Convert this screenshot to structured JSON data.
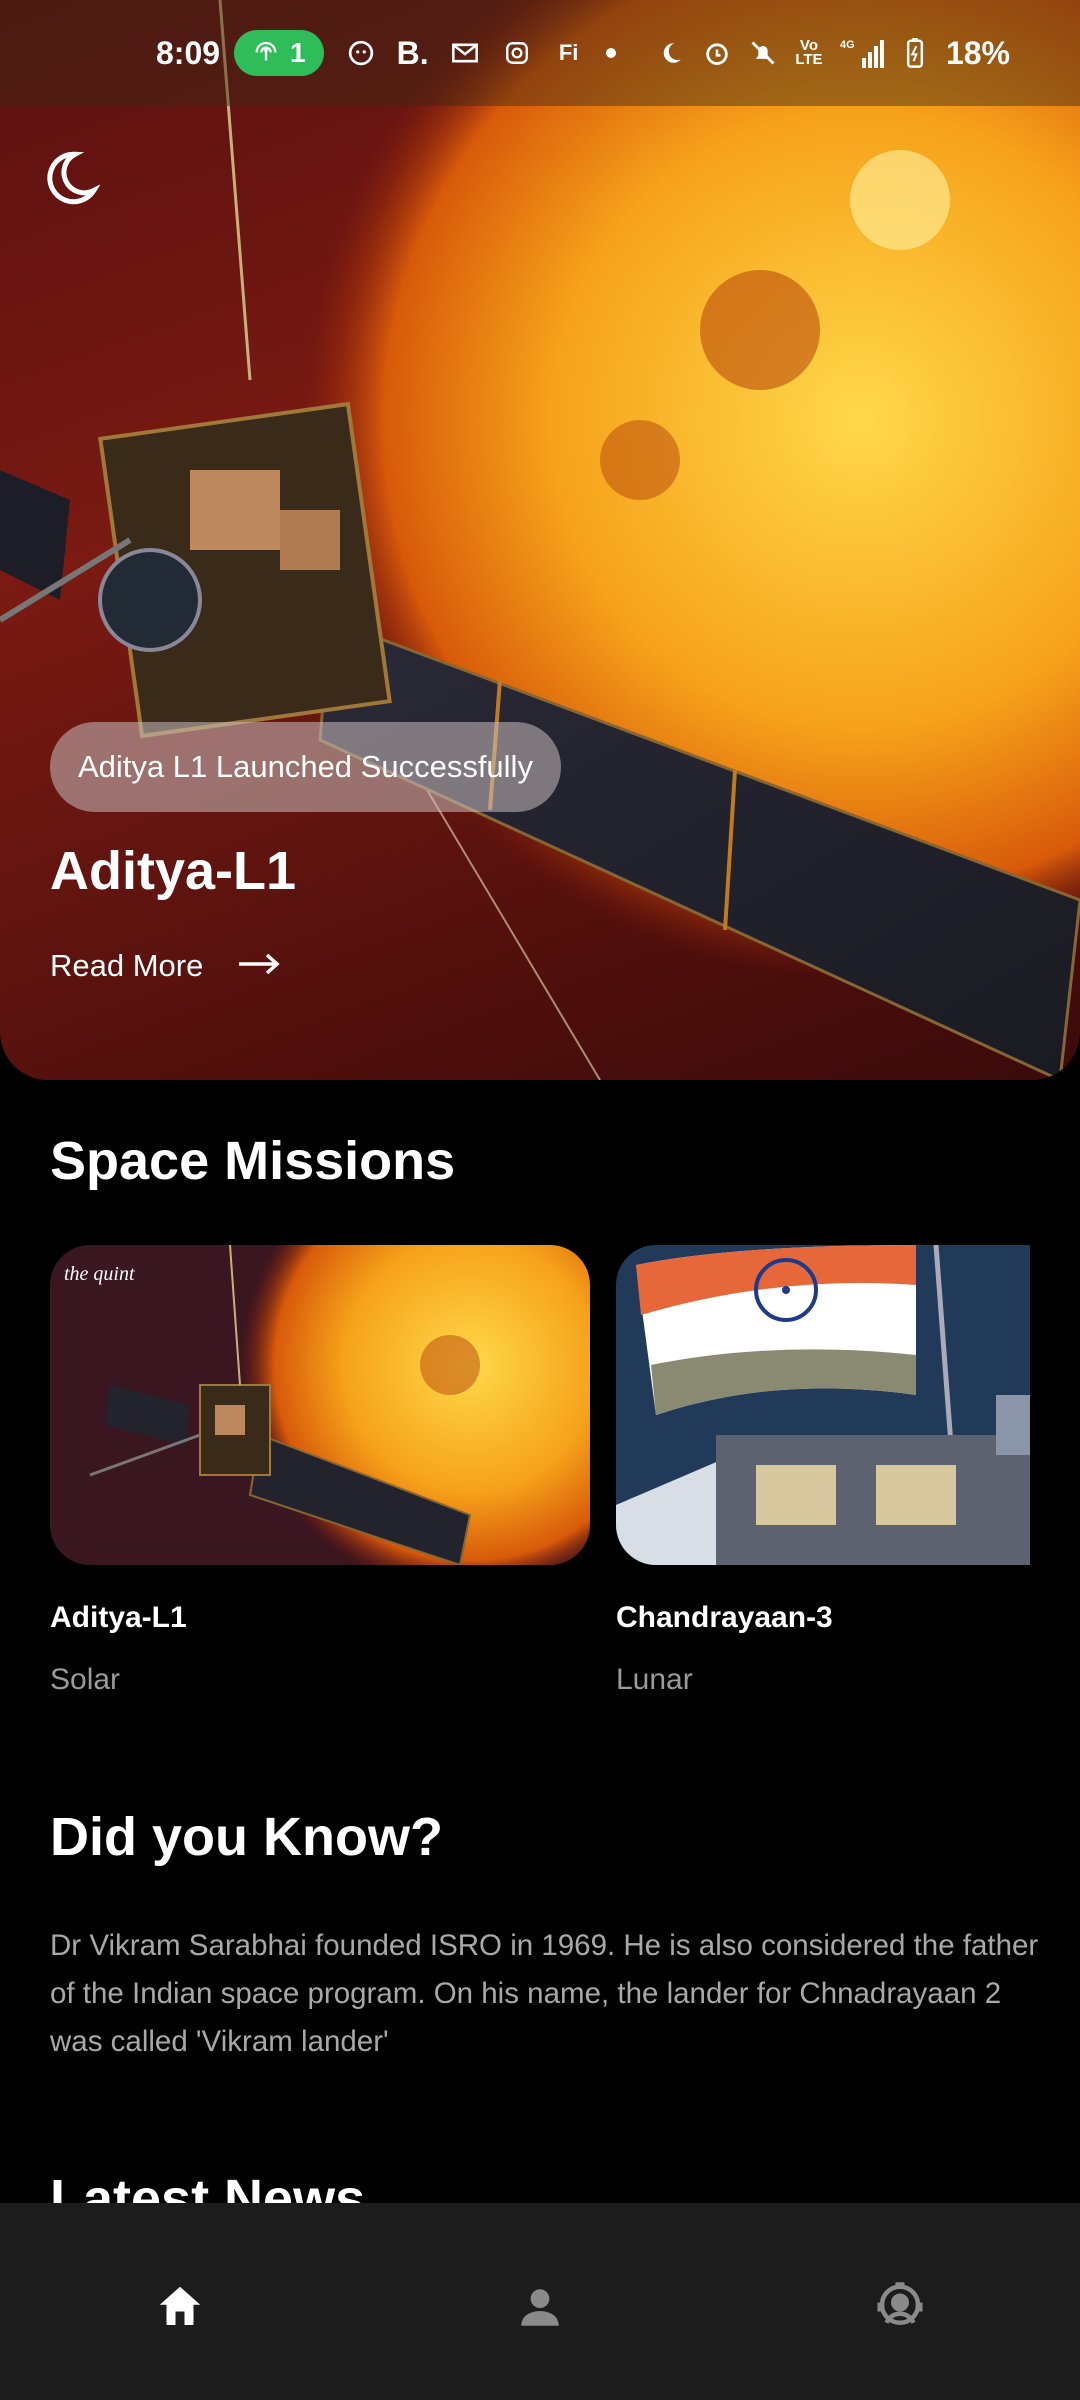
{
  "status_bar": {
    "time": "8:09",
    "hotspot_count": "1",
    "battery": "18%",
    "left_icons": [
      "hotspot-icon",
      "lion-app-icon",
      "b-app-icon",
      "gmail-icon",
      "instagram-icon",
      "fi-app-icon",
      "dot-icon"
    ],
    "right_icons": [
      "moon-icon",
      "alarm-icon",
      "mute-icon",
      "volte-icon",
      "signal-icon",
      "battery-icon"
    ]
  },
  "hero": {
    "badge": "Aditya L1 Launched Successfully",
    "title": "Aditya-L1",
    "read_more": "Read More"
  },
  "sections": {
    "missions_title": "Space Missions",
    "did_you_know_title": "Did you Know?",
    "latest_news_title": "Latest News"
  },
  "missions": [
    {
      "name": "Aditya-L1",
      "type": "Solar",
      "watermark": "the quint"
    },
    {
      "name": "Chandrayaan-3",
      "type": "Lunar"
    }
  ],
  "did_you_know": "Dr Vikram Sarabhai founded ISRO in 1969. He is also considered the father of the Indian space program. On his name, the lander for Chnadrayaan 2 was called 'Vikram lander'",
  "bottom_nav": [
    {
      "icon": "home-icon",
      "active": true
    },
    {
      "icon": "profile-icon",
      "active": false
    },
    {
      "icon": "astronaut-icon",
      "active": false
    }
  ],
  "colors": {
    "background": "#000000",
    "nav_bg": "#1c1c1c",
    "hotspot_green": "#2ebd59",
    "muted_text": "#9a9a9a"
  }
}
